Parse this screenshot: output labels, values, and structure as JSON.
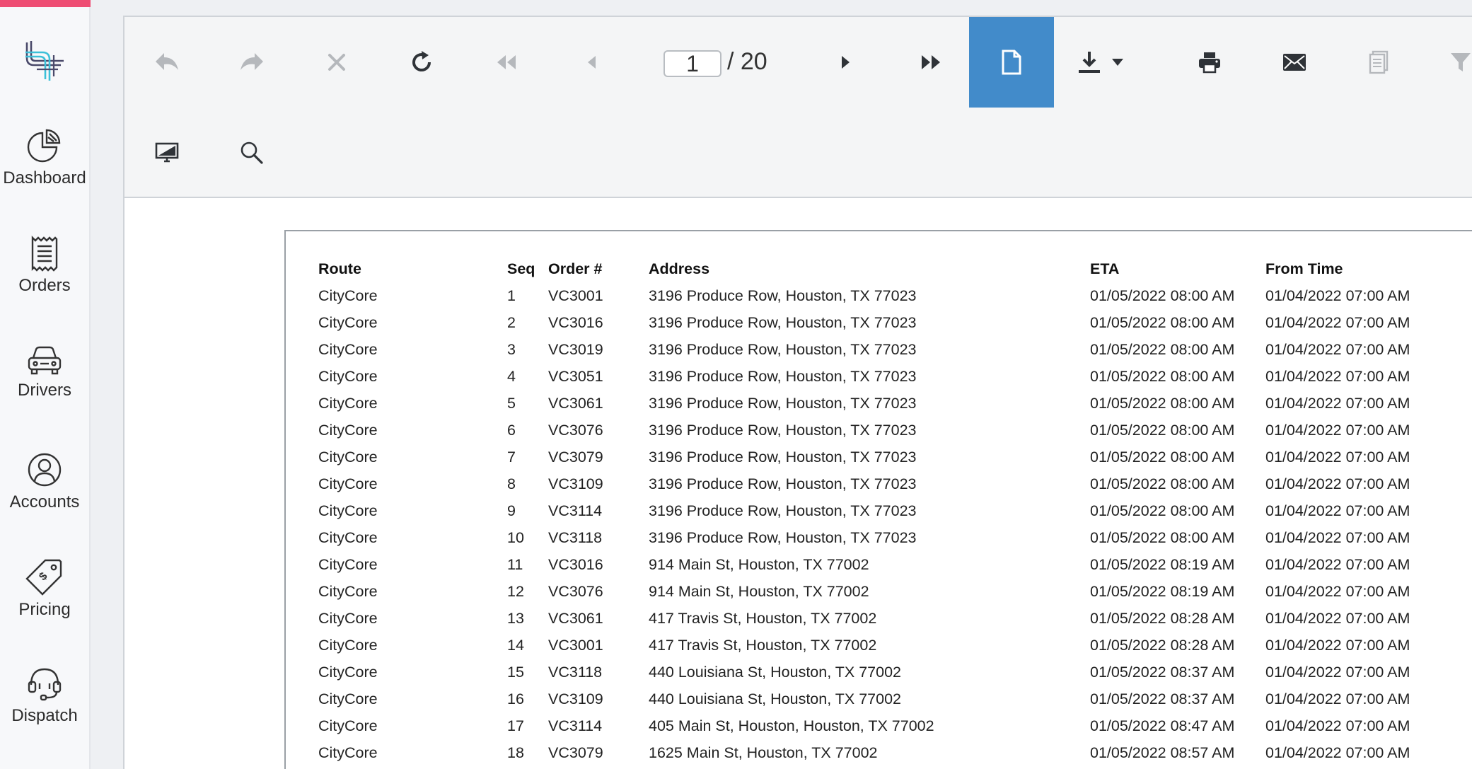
{
  "sidebar": {
    "items": [
      {
        "label": "Dashboard",
        "icon": "pie-chart-icon"
      },
      {
        "label": "Orders",
        "icon": "receipt-icon"
      },
      {
        "label": "Drivers",
        "icon": "car-icon"
      },
      {
        "label": "Accounts",
        "icon": "user-circle-icon"
      },
      {
        "label": "Pricing",
        "icon": "price-tag-icon"
      },
      {
        "label": "Dispatch",
        "icon": "headset-icon"
      }
    ]
  },
  "toolbar": {
    "current_page": "1",
    "page_total": "/ 20",
    "active_color": "#428bca"
  },
  "report": {
    "headers": {
      "route": "Route",
      "seq": "Seq",
      "order": "Order #",
      "address": "Address",
      "eta": "ETA",
      "from_time": "From Time"
    },
    "rows": [
      {
        "route": "CityCore",
        "seq": "1",
        "order": "VC3001",
        "address": "3196 Produce Row, Houston, TX 77023",
        "eta": "01/05/2022 08:00 AM",
        "from_time": "01/04/2022 07:00 AM"
      },
      {
        "route": "CityCore",
        "seq": "2",
        "order": "VC3016",
        "address": "3196 Produce Row, Houston, TX 77023",
        "eta": "01/05/2022 08:00 AM",
        "from_time": "01/04/2022 07:00 AM"
      },
      {
        "route": "CityCore",
        "seq": "3",
        "order": "VC3019",
        "address": "3196 Produce Row, Houston, TX 77023",
        "eta": "01/05/2022 08:00 AM",
        "from_time": "01/04/2022 07:00 AM"
      },
      {
        "route": "CityCore",
        "seq": "4",
        "order": "VC3051",
        "address": "3196 Produce Row, Houston, TX 77023",
        "eta": "01/05/2022 08:00 AM",
        "from_time": "01/04/2022 07:00 AM"
      },
      {
        "route": "CityCore",
        "seq": "5",
        "order": "VC3061",
        "address": "3196 Produce Row, Houston, TX 77023",
        "eta": "01/05/2022 08:00 AM",
        "from_time": "01/04/2022 07:00 AM"
      },
      {
        "route": "CityCore",
        "seq": "6",
        "order": "VC3076",
        "address": "3196 Produce Row, Houston, TX 77023",
        "eta": "01/05/2022 08:00 AM",
        "from_time": "01/04/2022 07:00 AM"
      },
      {
        "route": "CityCore",
        "seq": "7",
        "order": "VC3079",
        "address": "3196 Produce Row, Houston, TX 77023",
        "eta": "01/05/2022 08:00 AM",
        "from_time": "01/04/2022 07:00 AM"
      },
      {
        "route": "CityCore",
        "seq": "8",
        "order": "VC3109",
        "address": "3196 Produce Row, Houston, TX 77023",
        "eta": "01/05/2022 08:00 AM",
        "from_time": "01/04/2022 07:00 AM"
      },
      {
        "route": "CityCore",
        "seq": "9",
        "order": "VC3114",
        "address": "3196 Produce Row, Houston, TX 77023",
        "eta": "01/05/2022 08:00 AM",
        "from_time": "01/04/2022 07:00 AM"
      },
      {
        "route": "CityCore",
        "seq": "10",
        "order": "VC3118",
        "address": "3196 Produce Row, Houston, TX 77023",
        "eta": "01/05/2022 08:00 AM",
        "from_time": "01/04/2022 07:00 AM"
      },
      {
        "route": "CityCore",
        "seq": "11",
        "order": "VC3016",
        "address": "914 Main St, Houston, TX 77002",
        "eta": "01/05/2022 08:19 AM",
        "from_time": "01/04/2022 07:00 AM"
      },
      {
        "route": "CityCore",
        "seq": "12",
        "order": "VC3076",
        "address": "914 Main St, Houston, TX 77002",
        "eta": "01/05/2022 08:19 AM",
        "from_time": "01/04/2022 07:00 AM"
      },
      {
        "route": "CityCore",
        "seq": "13",
        "order": "VC3061",
        "address": "417 Travis St, Houston, TX 77002",
        "eta": "01/05/2022 08:28 AM",
        "from_time": "01/04/2022 07:00 AM"
      },
      {
        "route": "CityCore",
        "seq": "14",
        "order": "VC3001",
        "address": "417 Travis St, Houston, TX 77002",
        "eta": "01/05/2022 08:28 AM",
        "from_time": "01/04/2022 07:00 AM"
      },
      {
        "route": "CityCore",
        "seq": "15",
        "order": "VC3118",
        "address": "440 Louisiana St, Houston, TX 77002",
        "eta": "01/05/2022 08:37 AM",
        "from_time": "01/04/2022 07:00 AM"
      },
      {
        "route": "CityCore",
        "seq": "16",
        "order": "VC3109",
        "address": "440 Louisiana St, Houston, TX 77002",
        "eta": "01/05/2022 08:37 AM",
        "from_time": "01/04/2022 07:00 AM"
      },
      {
        "route": "CityCore",
        "seq": "17",
        "order": "VC3114",
        "address": "405 Main St, Houston, Houston, TX 77002",
        "eta": "01/05/2022 08:47 AM",
        "from_time": "01/04/2022 07:00 AM"
      },
      {
        "route": "CityCore",
        "seq": "18",
        "order": "VC3079",
        "address": "1625 Main St, Houston, TX 77002",
        "eta": "01/05/2022 08:57 AM",
        "from_time": "01/04/2022 07:00 AM"
      }
    ]
  }
}
